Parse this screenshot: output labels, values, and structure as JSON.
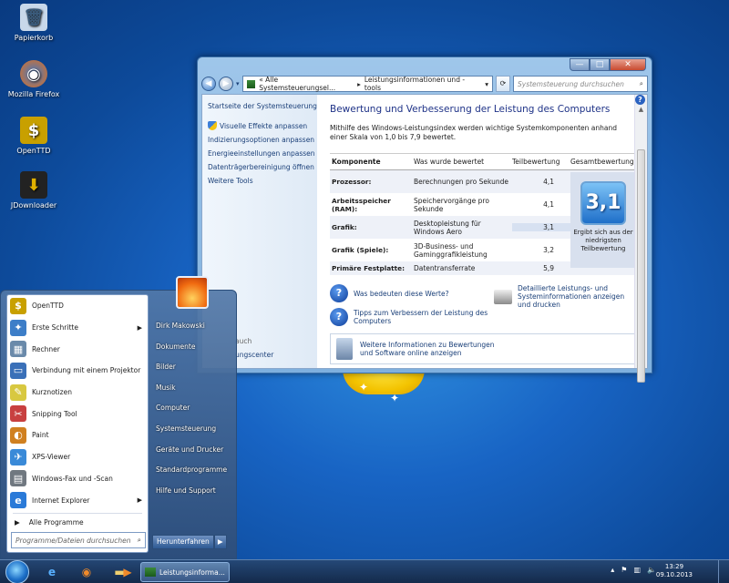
{
  "desktop": {
    "icons": [
      {
        "label": "Papierkorb",
        "glyph": "🗑",
        "color": "#c8d8ea"
      },
      {
        "label": "Mozilla Firefox",
        "glyph": "◉",
        "color": "#e8701a"
      },
      {
        "label": "OpenTTD",
        "glyph": "$",
        "color": "#c8a000"
      },
      {
        "label": "JDownloader",
        "glyph": "⬇",
        "color": "#e0b000"
      }
    ]
  },
  "window": {
    "controls": {
      "minimize": "—",
      "maximize": "□",
      "close": "✕"
    },
    "breadcrumb": {
      "part1": "« Alle Systemsteuerungsel...",
      "sep": "▸",
      "part2": "Leistungsinformationen und -tools"
    },
    "search_placeholder": "Systemsteuerung durchsuchen",
    "left_pane": {
      "home": "Startseite der Systemsteuerung",
      "links": [
        "Visuelle Effekte anpassen",
        "Indizierungsoptionen anpassen",
        "Energieeinstellungen anpassen",
        "Datenträgerbereinigung öffnen",
        "Weitere Tools"
      ]
    },
    "heading": "Bewertung und Verbesserung der Leistung des Computers",
    "intro": "Mithilfe des Windows-Leistungsindex werden wichtige Systemkomponenten anhand einer Skala von 1,0 bis 7,9 bewertet.",
    "table": {
      "headers": [
        "Komponente",
        "Was wurde bewertet",
        "Teilbewertung",
        "Gesamtbewertung"
      ],
      "rows": [
        {
          "component": "Prozessor:",
          "rated": "Berechnungen pro Sekunde",
          "score": "4,1"
        },
        {
          "component": "Arbeitsspeicher (RAM):",
          "rated": "Speichervorgänge pro Sekunde",
          "score": "4,1"
        },
        {
          "component": "Grafik:",
          "rated": "Desktopleistung für Windows Aero",
          "score": "3,1"
        },
        {
          "component": "Grafik (Spiele):",
          "rated": "3D-Business- und Gaminggrafikleistung",
          "score": "3,2"
        },
        {
          "component": "Primäre Festplatte:",
          "rated": "Datentransferrate",
          "score": "5,9"
        }
      ],
      "overall_score": "3,1",
      "overall_text": "Ergibt sich aus der niedrigsten Teilbewertung"
    },
    "links": {
      "what_mean": "Was bedeuten diese Werte?",
      "tips": "Tipps zum Verbessern der Leistung des Computers",
      "detailed": "Detaillierte Leistungs- und Systeminformationen anzeigen und drucken",
      "more_info": "Weitere Informationen zu Bewertungen und Software online anzeigen"
    }
  },
  "start_menu": {
    "programs": [
      {
        "label": "OpenTTD",
        "glyph": "$",
        "color": "#c8a000",
        "arrow": ""
      },
      {
        "label": "Erste Schritte",
        "glyph": "✦",
        "color": "#3d7ec8",
        "arrow": "▶"
      },
      {
        "label": "Rechner",
        "glyph": "▦",
        "color": "#6a8aaa",
        "arrow": ""
      },
      {
        "label": "Verbindung mit einem Projektor",
        "glyph": "▭",
        "color": "#3a70b8",
        "arrow": ""
      },
      {
        "label": "Kurznotizen",
        "glyph": "✎",
        "color": "#d8c840",
        "arrow": ""
      },
      {
        "label": "Snipping Tool",
        "glyph": "✂",
        "color": "#c84040",
        "arrow": ""
      },
      {
        "label": "Paint",
        "glyph": "◐",
        "color": "#d08020",
        "arrow": ""
      },
      {
        "label": "XPS-Viewer",
        "glyph": "✈",
        "color": "#3a8ad8",
        "arrow": ""
      },
      {
        "label": "Windows-Fax und -Scan",
        "glyph": "▤",
        "color": "#707880",
        "arrow": ""
      },
      {
        "label": "Internet Explorer",
        "glyph": "e",
        "color": "#2a7ad8",
        "arrow": "▶"
      }
    ],
    "all_programs": "Alle Programme",
    "search_placeholder": "Programme/Dateien durchsuchen",
    "right_items": [
      "Dirk Makowski",
      "Dokumente",
      "Bilder",
      "Musik",
      "Computer",
      "Systemsteuerung",
      "Geräte und Drucker",
      "Standardprogramme",
      "Hilfe und Support"
    ],
    "shutdown_label": "Herunterfahren",
    "shutdown_arrow": "▶"
  },
  "behind_text": {
    "line1": "auch",
    "line2": "ungscenter"
  },
  "taskbar": {
    "active_task": "Leistungsinforma...",
    "time": "13:29",
    "date": "09.10.2013"
  }
}
